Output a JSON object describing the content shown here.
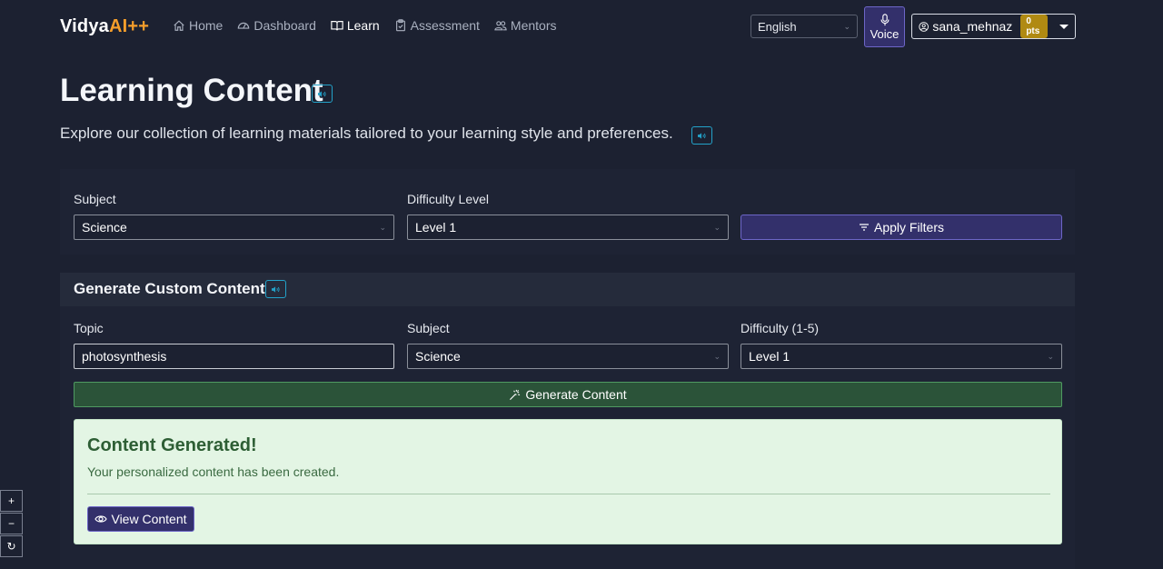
{
  "brand": {
    "name": "Vidya",
    "accent": "AI++"
  },
  "nav": {
    "items": [
      {
        "label": "Home",
        "icon": "home-icon"
      },
      {
        "label": "Dashboard",
        "icon": "dashboard-icon"
      },
      {
        "label": "Learn",
        "icon": "book-icon",
        "active": true
      },
      {
        "label": "Assessment",
        "icon": "clipboard-check-icon"
      },
      {
        "label": "Mentors",
        "icon": "people-icon"
      }
    ]
  },
  "language": {
    "selected": "English"
  },
  "voice": {
    "label": "Voice",
    "icon": "mic-icon"
  },
  "user": {
    "name": "sana_mehnaz",
    "points": "0 pts",
    "icon": "person-circle-icon"
  },
  "header": {
    "title": "Learning Content",
    "subtitle": "Explore our collection of learning materials tailored to your learning style and preferences."
  },
  "filters": {
    "subject_label": "Subject",
    "subject_value": "Science",
    "difficulty_label": "Difficulty Level",
    "difficulty_value": "Level 1",
    "apply_label": "Apply Filters"
  },
  "custom": {
    "title": "Generate Custom Content",
    "topic_label": "Topic",
    "topic_value": "photosynthesis",
    "subject_label": "Subject",
    "subject_value": "Science",
    "difficulty_label": "Difficulty (1-5)",
    "difficulty_value": "Level 1",
    "generate_label": "Generate Content"
  },
  "result": {
    "title": "Content Generated!",
    "message": "Your personalized content has been created.",
    "view_label": "View Content"
  },
  "zoom": {
    "in": "+",
    "out": "−",
    "reset": "↻"
  },
  "colors": {
    "background": "#1c2131",
    "brand_accent": "#f59e2b",
    "primary_button": "#33306b",
    "success_button": "#2b5339",
    "alert_bg": "#e3f5e4",
    "badge": "#b08a12",
    "speak_border": "#23a2c9"
  }
}
